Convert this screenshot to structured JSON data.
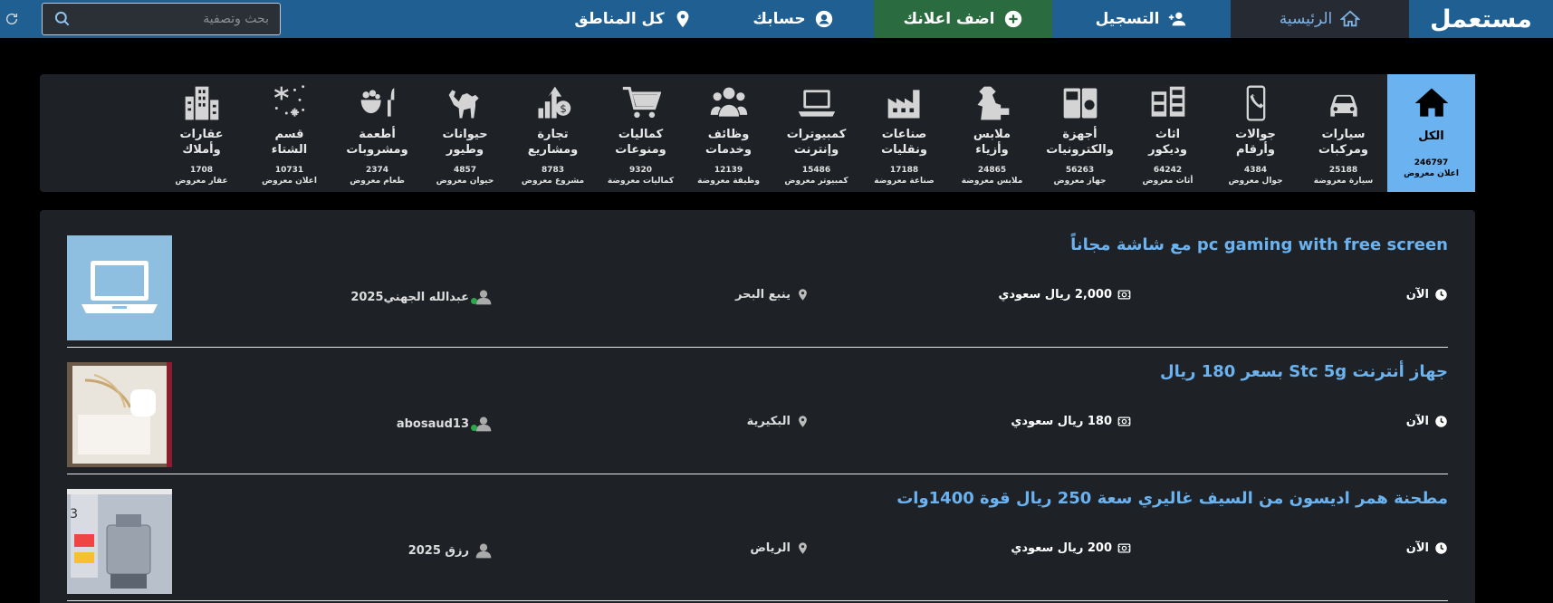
{
  "header": {
    "logo": "مستعمل",
    "nav": {
      "home": "الرئيسية",
      "register": "التسجيل",
      "add_listing": "اضف اعلانك",
      "account": "حسابك",
      "regions": "كل المناطق"
    },
    "search_placeholder": "بحث وتصفية",
    "colors": {
      "bar": "#1f5f92",
      "home_bg": "#262b33",
      "add_bg": "#2a6b3f"
    }
  },
  "categories": [
    {
      "name": "الكل",
      "count": "246797",
      "unit": "اعلان معروض",
      "icon": "home-icon",
      "active": true
    },
    {
      "name": "سيارات\nومركبات",
      "count": "25188",
      "unit": "سيارة معروضة",
      "icon": "car-icon"
    },
    {
      "name": "جوالات\nوأرقام",
      "count": "4384",
      "unit": "جوال معروض",
      "icon": "phone-icon"
    },
    {
      "name": "اثاث\nوديكور",
      "count": "64242",
      "unit": "أثاث معروض",
      "icon": "furniture-icon"
    },
    {
      "name": "أجهزة\nوالكترونيات",
      "count": "56263",
      "unit": "جهاز معروض",
      "icon": "appliances-icon"
    },
    {
      "name": "ملابس\nوأزياء",
      "count": "24865",
      "unit": "ملابس معروضة",
      "icon": "clothes-icon"
    },
    {
      "name": "صناعات\nونقليات",
      "count": "17188",
      "unit": "صناعة معروضة",
      "icon": "factory-icon"
    },
    {
      "name": "كمبيوترات\nوإنترنت",
      "count": "15486",
      "unit": "كمبيوتر معروض",
      "icon": "laptop-icon"
    },
    {
      "name": "وظائف\nوخدمات",
      "count": "12139",
      "unit": "وظيفة معروضة",
      "icon": "people-icon"
    },
    {
      "name": "كماليات\nومنوعات",
      "count": "9320",
      "unit": "كماليات معروضة",
      "icon": "cart-icon"
    },
    {
      "name": "تجارة\nومشاريع",
      "count": "8783",
      "unit": "مشروع معروض",
      "icon": "business-icon"
    },
    {
      "name": "حيوانات\nوطيور",
      "count": "4857",
      "unit": "حيوان معروض",
      "icon": "camel-icon"
    },
    {
      "name": "أطعمة\nومشروبات",
      "count": "2374",
      "unit": "طعام معروض",
      "icon": "food-icon"
    },
    {
      "name": "قسم\nالشتاء",
      "count": "10731",
      "unit": "اعلان معروض",
      "icon": "snow-icon"
    },
    {
      "name": "عقارات\nوأملاك",
      "count": "1708",
      "unit": "عقار معروض",
      "icon": "building-icon"
    }
  ],
  "listings": [
    {
      "title": "pc gaming with free screen مع شاشة مجاناً",
      "time": "الآن",
      "price": "2,000 ريال سعودي",
      "location": "ينبع البحر",
      "user": "عبدالله الجهني2025",
      "online": true,
      "thumb": "laptop-placeholder"
    },
    {
      "title": "جهاز أنترنت Stc 5g بسعر 180 ريال",
      "time": "الآن",
      "price": "180 ريال سعودي",
      "location": "البكيرية",
      "user": "abosaud13",
      "online": true,
      "thumb": "router-photo"
    },
    {
      "title": "مطحنة همر اديسون من السيف غاليري سعة 250 ريال قوة 1400وات",
      "time": "الآن",
      "price": "200 ريال سعودي",
      "location": "الرياض",
      "user": "رزق 2025",
      "online": false,
      "thumb": "grinder-photo"
    }
  ]
}
